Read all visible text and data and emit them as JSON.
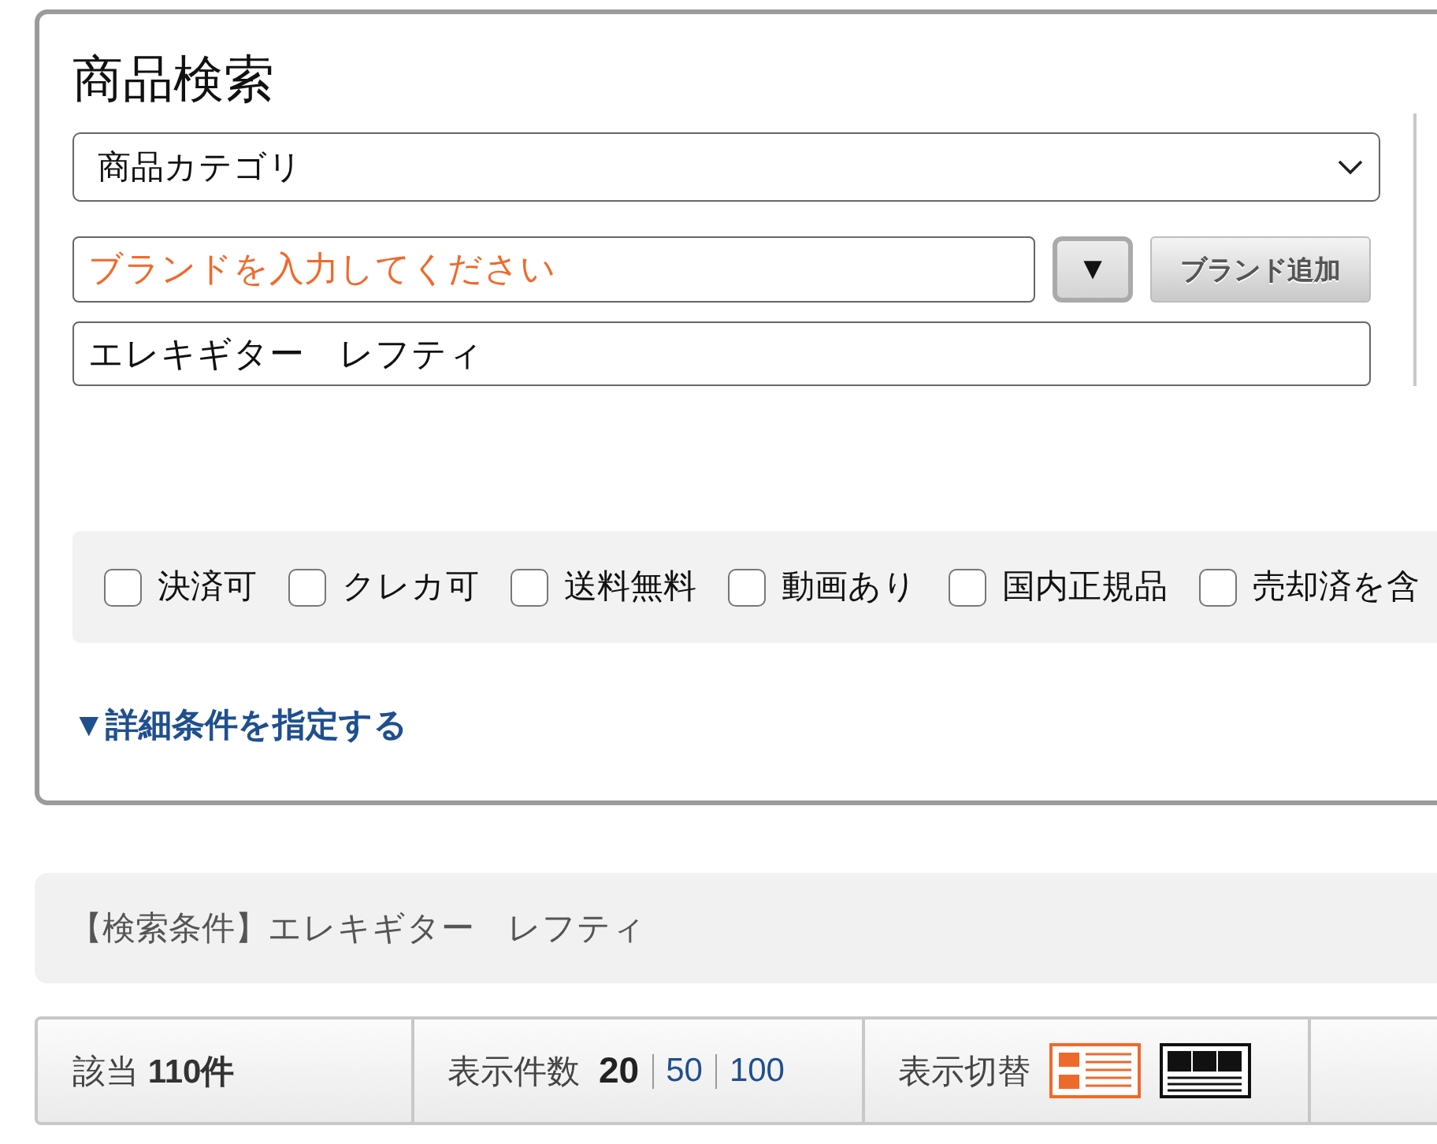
{
  "search_panel": {
    "title": "商品検索",
    "category_select": {
      "value": "商品カテゴリ"
    },
    "brand_field": {
      "placeholder": "ブランドを入力してください"
    },
    "brand_dropdown_button": {
      "label": "▼"
    },
    "add_brand_button": {
      "label": "ブランド追加"
    },
    "keyword_field": {
      "value": "エレキギター　レフティ"
    },
    "filters": [
      {
        "label": "決済可",
        "checked": false
      },
      {
        "label": "クレカ可",
        "checked": false
      },
      {
        "label": "送料無料",
        "checked": false
      },
      {
        "label": "動画あり",
        "checked": false
      },
      {
        "label": "国内正規品",
        "checked": false
      },
      {
        "label": "売却済を含",
        "checked": false
      }
    ],
    "advanced_link": "▼詳細条件を指定する"
  },
  "search_conditions": {
    "text": "【検索条件】エレキギター　レフティ"
  },
  "results_bar": {
    "count": "該当 **110件**",
    "per_page_label": "表示件数",
    "per_page_options": [
      {
        "label": "20",
        "selected": true
      },
      {
        "label": "50",
        "selected": false
      },
      {
        "label": "100",
        "selected": false
      }
    ],
    "view_label": "表示切替",
    "views": [
      {
        "kind": "list",
        "selected": true
      },
      {
        "kind": "grid",
        "selected": false
      }
    ]
  }
}
